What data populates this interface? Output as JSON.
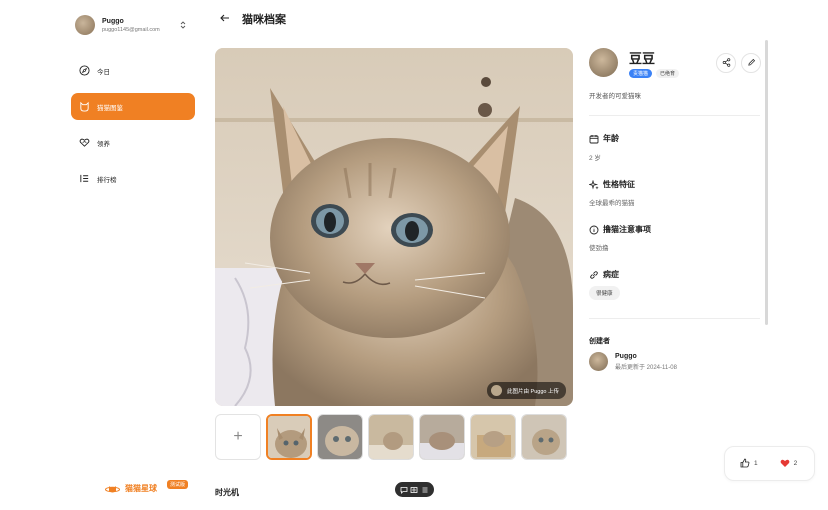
{
  "user": {
    "name": "Puggo",
    "email": "puggo1145@gmail.com"
  },
  "nav": [
    {
      "label": "今日",
      "icon": "compass-icon"
    },
    {
      "label": "猫猫图鉴",
      "icon": "cat-icon"
    },
    {
      "label": "领养",
      "icon": "heart-hand-icon"
    },
    {
      "label": "排行榜",
      "icon": "ranking-list-icon"
    }
  ],
  "brand": {
    "name": "猫猫星球",
    "badge": "测试版"
  },
  "header": {
    "title": "猫咪档案"
  },
  "photo": {
    "caption": "此图片由 Puggo 上传"
  },
  "timemachine": "时光机",
  "pet": {
    "name": "豆豆",
    "tags": [
      "责猫猫",
      "已绝育"
    ],
    "description": "开发者的可爱猫咪",
    "sections": {
      "age": {
        "title": "年龄",
        "value": "2 岁"
      },
      "personality": {
        "title": "性格特征",
        "value": "全球最乖的猫猫"
      },
      "notes": {
        "title": "撸猫注意事项",
        "value": "使劲撸"
      },
      "disease": {
        "title": "病症",
        "value": "很健康"
      }
    },
    "creator": {
      "label": "创建者",
      "name": "Puggo",
      "updated": "最后更新于 2024-11-08"
    }
  },
  "reactions": {
    "likes": "1",
    "hearts": "2"
  },
  "colors": {
    "accent": "#f08023",
    "tag_blue": "#3b82f6",
    "heart": "#e53935"
  }
}
